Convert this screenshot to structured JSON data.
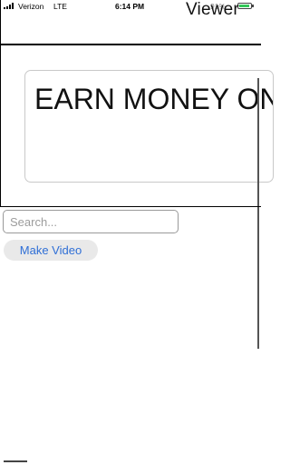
{
  "status_bar": {
    "carrier": "Verizon",
    "network": "LTE",
    "time": "6:14 PM",
    "battery_text": "91%",
    "battery_color": "#34c759"
  },
  "header": {
    "title": "Viewer"
  },
  "banner": {
    "text": "EARN MONEY ON"
  },
  "search": {
    "placeholder": "Search...",
    "value": ""
  },
  "actions": {
    "make_video_label": "Make Video",
    "accent_color": "#2f6fd6"
  }
}
